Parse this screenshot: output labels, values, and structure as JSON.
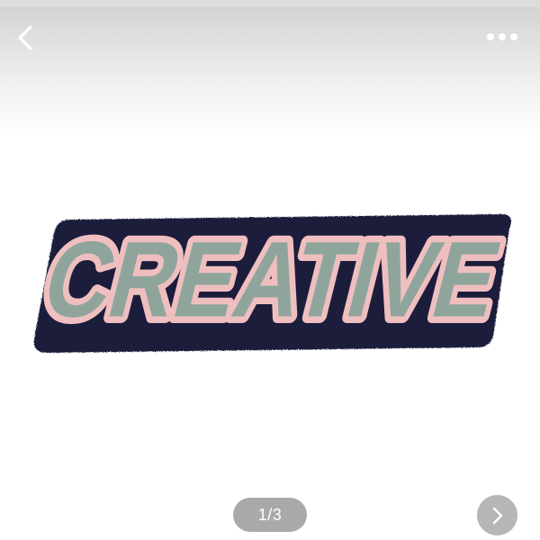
{
  "header": {
    "back_icon": "chevron-left-icon",
    "more_icon": "more-horizontal-icon"
  },
  "photo": {
    "rug_text": "CREATIVE",
    "colors": {
      "outline": "#1c1a3a",
      "border": "#efbfbf",
      "letters": "#8fa59c"
    }
  },
  "pager": {
    "indicator": "1/3",
    "next_icon": "chevron-right-icon"
  }
}
